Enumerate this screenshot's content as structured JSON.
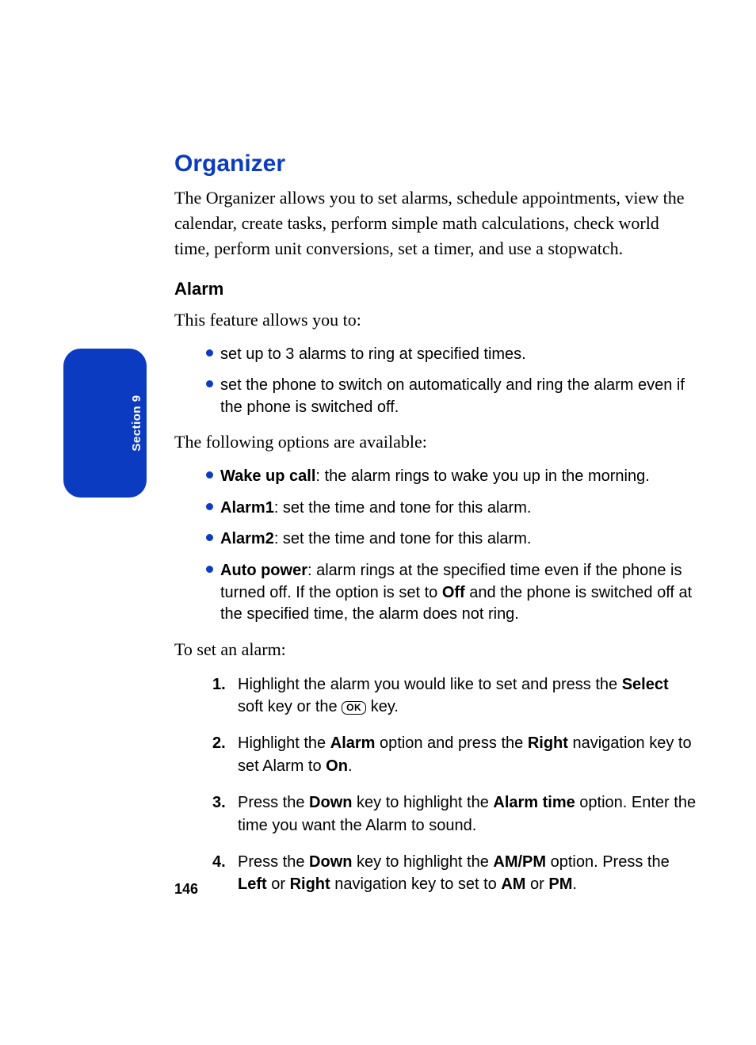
{
  "sidebar": {
    "label": "Section  9"
  },
  "heading": "Organizer",
  "intro": "The Organizer allows you to set alarms, schedule appointments, view the calendar, create tasks, perform simple math calculations, check world time, perform unit conversions, set a timer, and use a stopwatch.",
  "alarm": {
    "heading": "Alarm",
    "lead": "This feature allows you to:",
    "features": [
      "set up to 3 alarms to ring at specified times.",
      "set the phone to switch on automatically and ring the alarm even if the phone is switched off."
    ],
    "options_lead": "The following options are available:",
    "options": [
      {
        "bold": "Wake up call",
        "rest": ": the alarm rings to wake you up in the morning."
      },
      {
        "bold": "Alarm1",
        "rest": ": set the time and tone for this alarm."
      },
      {
        "bold": "Alarm2",
        "rest": ": set the time and tone for this alarm."
      },
      {
        "bold": "Auto power",
        "rest_pre": ": alarm rings at the specified time even if the phone is turned off. If the option is set to ",
        "rest_bold": "Off",
        "rest_post": " and the phone is switched off at the specified time, the alarm does not ring."
      }
    ],
    "steps_lead": "To set an alarm:",
    "steps": {
      "s1": {
        "num": "1.",
        "a": "Highlight the alarm you would like to set and press the ",
        "b1": "Select",
        "b": " soft key or the ",
        "ok": "OK",
        "c": " key."
      },
      "s2": {
        "num": "2.",
        "a": "Highlight the ",
        "b1": "Alarm",
        "b": " option and press the ",
        "b2": "Right",
        "c": " navigation key to set Alarm to ",
        "b3": "On",
        "d": "."
      },
      "s3": {
        "num": "3.",
        "a": "Press the ",
        "b1": "Down",
        "b": " key to highlight the ",
        "b2": "Alarm time",
        "c": " option. Enter the time you want the Alarm to sound."
      },
      "s4": {
        "num": "4.",
        "a": "Press the ",
        "b1": "Down",
        "b": " key to highlight the ",
        "b2": "AM/PM",
        "c": " option. Press the ",
        "b3": "Left",
        "d": " or ",
        "b4": "Right",
        "e": " navigation key to set to ",
        "b5": "AM",
        "f": " or ",
        "b6": "PM",
        "g": "."
      }
    }
  },
  "page_number": "146"
}
